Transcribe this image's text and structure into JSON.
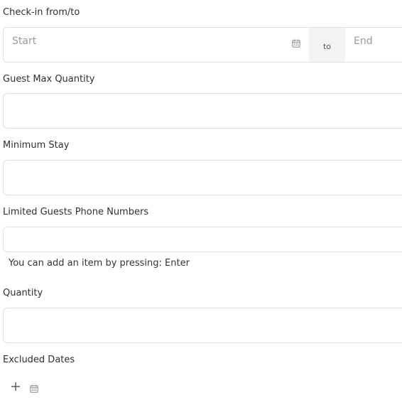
{
  "checkin": {
    "label": "Check-in from/to",
    "start_placeholder": "Start",
    "separator": "to",
    "end_placeholder": "End"
  },
  "guest_max_quantity": {
    "label": "Guest Max Quantity",
    "value": ""
  },
  "minimum_stay": {
    "label": "Minimum Stay",
    "value": ""
  },
  "limited_guests_phone_numbers": {
    "label": "Limited Guests Phone Numbers",
    "value": "",
    "hint": "You can add an item by pressing: Enter"
  },
  "quantity": {
    "label": "Quantity",
    "value": ""
  },
  "excluded_dates": {
    "label": "Excluded Dates"
  },
  "icons": {
    "calendar": "calendar-icon",
    "add": "plus-icon"
  },
  "colors": {
    "border": "#e0e0e0",
    "placeholder": "#9a9a9a",
    "separator_bg": "#f3f3f3"
  }
}
